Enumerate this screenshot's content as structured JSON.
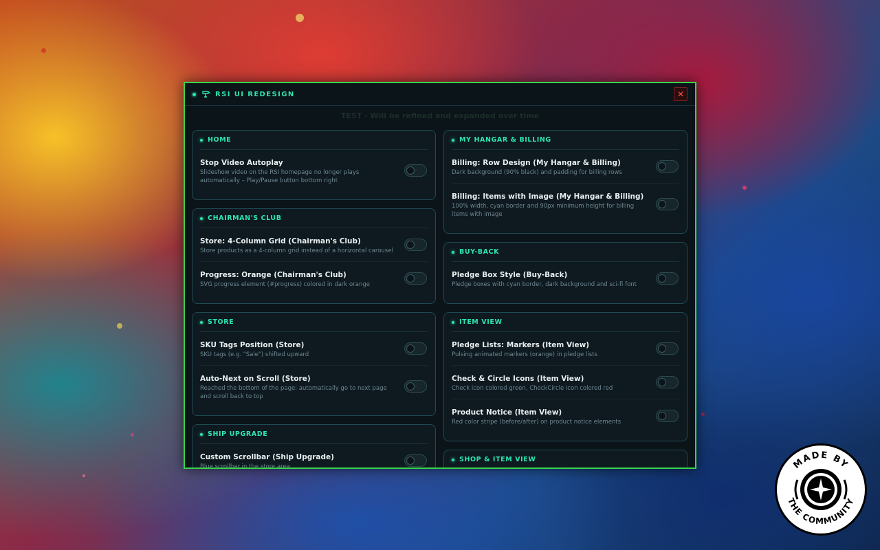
{
  "window": {
    "title": "RSI UI REDESIGN",
    "close_label": "✕",
    "notice": "TEST - Will be refined and expanded over time"
  },
  "left_column": [
    {
      "title": "HOME",
      "items": [
        {
          "title": "Stop Video Autoplay",
          "desc": "Slideshow video on the RSI homepage no longer plays automatically – Play/Pause button bottom right",
          "enabled": false
        }
      ]
    },
    {
      "title": "CHAIRMAN'S CLUB",
      "items": [
        {
          "title": "Store: 4-Column Grid (Chairman's Club)",
          "desc": "Store products as a 4-column grid instead of a horizontal carousel",
          "enabled": false
        },
        {
          "title": "Progress: Orange (Chairman's Club)",
          "desc": "SVG progress element (#progress) colored in dark orange",
          "enabled": false
        }
      ]
    },
    {
      "title": "STORE",
      "items": [
        {
          "title": "SKU Tags Position (Store)",
          "desc": "SKU tags (e.g. \"Sale\") shifted upward",
          "enabled": false
        },
        {
          "title": "Auto-Next on Scroll (Store)",
          "desc": "Reached the bottom of the page: automatically go to next page and scroll back to top",
          "enabled": false
        }
      ]
    },
    {
      "title": "SHIP UPGRADE",
      "items": [
        {
          "title": "Custom Scrollbar (Ship Upgrade)",
          "desc": "Blue scrollbar in the store area",
          "enabled": false
        }
      ]
    }
  ],
  "right_column": [
    {
      "title": "MY HANGAR & BILLING",
      "items": [
        {
          "title": "Billing: Row Design (My Hangar & Billing)",
          "desc": "Dark background (90% black) and padding for billing rows",
          "enabled": false
        },
        {
          "title": "Billing: Items with Image (My Hangar & Billing)",
          "desc": "100% width, cyan border and 90px minimum height for billing items with image",
          "enabled": false
        }
      ]
    },
    {
      "title": "BUY-BACK",
      "items": [
        {
          "title": "Pledge Box Style (Buy-Back)",
          "desc": "Pledge boxes with cyan border, dark background and sci-fi font",
          "enabled": false
        }
      ]
    },
    {
      "title": "ITEM VIEW",
      "items": [
        {
          "title": "Pledge Lists: Markers (Item View)",
          "desc": "Pulsing animated markers (orange) in pledge lists",
          "enabled": false
        },
        {
          "title": "Check & Circle Icons (Item View)",
          "desc": "Check icon colored green, CheckCircle icon colored red",
          "enabled": false
        },
        {
          "title": "Product Notice (Item View)",
          "desc": "Red color stripe (before/after) on product notice elements",
          "enabled": false
        }
      ]
    },
    {
      "title": "SHOP & ITEM VIEW",
      "items": []
    }
  ],
  "badge": {
    "top_text": "MADE BY",
    "bottom_text": "THE COMMUNITY",
    "icon": "star-citizen-logo"
  },
  "colors": {
    "accent": "#2ee6b0",
    "border": "#39d44a",
    "panel": "#0b1419"
  }
}
